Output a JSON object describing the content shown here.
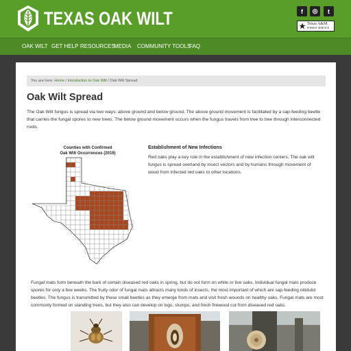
{
  "header": {
    "site_title": "TEXAS OAK WILT",
    "social": [
      {
        "icon": "facebook-icon",
        "glyph": "f"
      },
      {
        "icon": "instagram-icon",
        "glyph": "◎"
      },
      {
        "icon": "twitter-icon",
        "glyph": "t"
      }
    ],
    "partner_logo": {
      "line1": "Texas A&M",
      "line2": "FOREST SERVICE"
    }
  },
  "nav": {
    "items": [
      "OAK WILT",
      "GET HELP",
      "RESOURCES",
      "MEDIA",
      "COMMUNITY TOOLS",
      "FAQ"
    ]
  },
  "breadcrumb": {
    "prefix": "You are here:",
    "home": "Home",
    "sep1": " / ",
    "parent": "Introduction to Oak Wilt",
    "sep2": " / ",
    "current": "Oak Wilt Spread"
  },
  "main": {
    "title": "Oak Wilt Spread",
    "intro": "The Oak Wilt fungus is spread via two ways: above ground and below ground.  The above ground movement is facilitated by a sap-feeding beetle that carries the fungal spores to new trees.  The below ground movement occurs when the fungus travels from tree to tree through interconnected roots.",
    "map_title_line1": "Counties with Confirmed",
    "map_title_line2": "Oak Wilt Occurrences (2019)",
    "subheading": "Establishment of New Infections",
    "subpara": "Red oaks play a key role in the establishment of new infection centers.  The oak wilt fungus is spread overland by insect vectors and by humans through movement of wood from infected red oaks to other locations.",
    "para2": "Fungal mats form beneath the bark of certain diseased red oaks in spring, but do not form on white or live oaks.  Individual fungal mats produce spores for only a few weeks.  The fruity odor of fungal mats attracts many kinds of insects, the most important of which are sap-feeding nitidulid beetles.  The fungus is transmitted by these small beetles as they emerge from mats and visit fresh wounds on healthy oaks.  Fungal mats are most commonly formed on standing trees, but they also can develop on logs, stumps, and fresh firewood cut from diseased red oaks."
  },
  "colors": {
    "header_green": "#5a9e2a",
    "nav_green": "#4d8c24",
    "infected_county": "#a8471f",
    "link_green": "#3d7a20"
  }
}
